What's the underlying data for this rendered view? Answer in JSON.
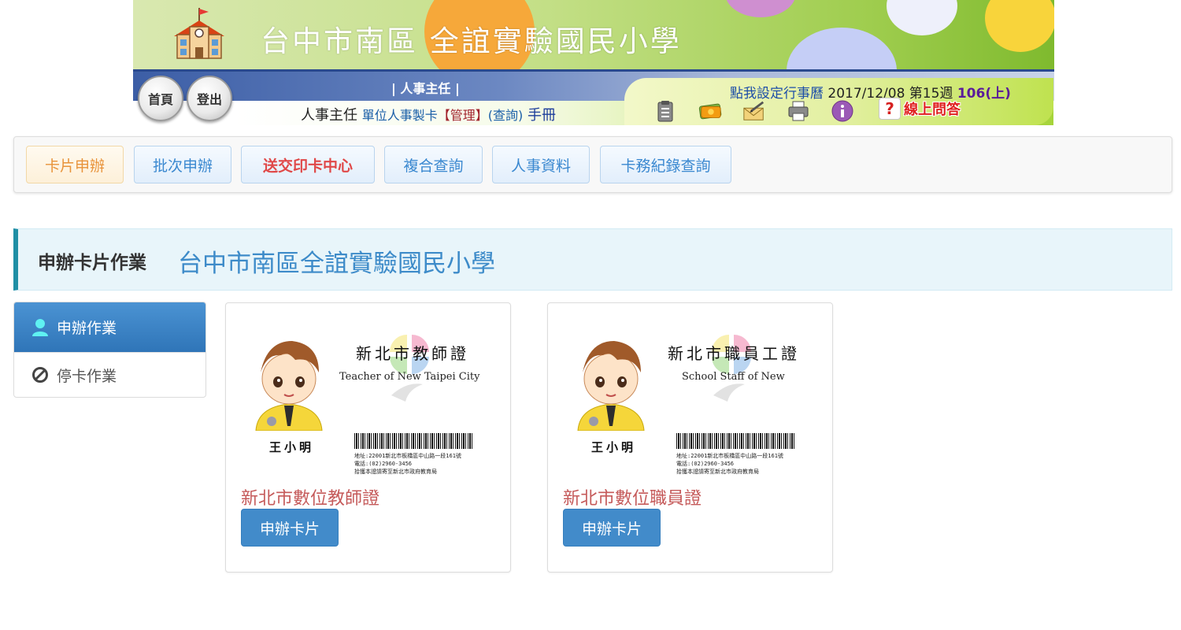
{
  "colors": {
    "accent_blue": "#428bca",
    "menu_text_blue": "#3a88d0",
    "menu_text_orange": "#e8933a",
    "menu_text_red": "#e04848",
    "card_title": "#c55a5a",
    "page_header_bg": "#e8f5fa"
  },
  "header": {
    "school_title": "台中市南區 全誼實驗國民小學",
    "role_title": "| 人事主任 |",
    "home_button": "首頁",
    "logout_button": "登出",
    "calendar_link": "點我設定行事曆",
    "date": "2017/12/08",
    "week": "第15週",
    "semester": "106(上)",
    "user_role": "人事主任",
    "card_link": "單位人事製卡",
    "manage_link": "【管理】",
    "query_link": "(查詢)",
    "manual_link": "手冊",
    "qa_label": "線上問答",
    "tool_icons": [
      "clipboard-icon",
      "money-icon",
      "mail-edit-icon",
      "printer-icon",
      "info-icon"
    ]
  },
  "menu": {
    "items": [
      {
        "label": "卡片申辦"
      },
      {
        "label": "批次申辦"
      },
      {
        "label": "送交印卡中心"
      },
      {
        "label": "複合查詢"
      },
      {
        "label": "人事資料"
      },
      {
        "label": "卡務紀錄查詢"
      }
    ]
  },
  "page": {
    "label": "申辦卡片作業",
    "school": "台中市南區全誼實驗國民小學"
  },
  "sidenav": {
    "items": [
      {
        "label": "申辦作業",
        "icon": "user-icon",
        "active": true
      },
      {
        "label": "停卡作業",
        "icon": "ban-icon",
        "active": false
      }
    ]
  },
  "cards": [
    {
      "title": "新北市數位教師證",
      "button": "申辦卡片",
      "image": {
        "title": "新北市教師證",
        "subtitle": "Teacher of New Taipei City",
        "name": "王小明",
        "address_line1": "地址:22001新北市板橋區中山路一段161號",
        "address_line2": "電話:(02)2960-3456",
        "address_line3": "拾獲本證請寄至新北市政府教育局"
      }
    },
    {
      "title": "新北市數位職員證",
      "button": "申辦卡片",
      "image": {
        "title": "新北市職員工證",
        "subtitle": "School Staff of New",
        "name": "王小明",
        "address_line1": "地址:22001新北市板橋區中山路一段161號",
        "address_line2": "電話:(02)2960-3456",
        "address_line3": "拾獲本證請寄至新北市政府教育局"
      }
    }
  ]
}
